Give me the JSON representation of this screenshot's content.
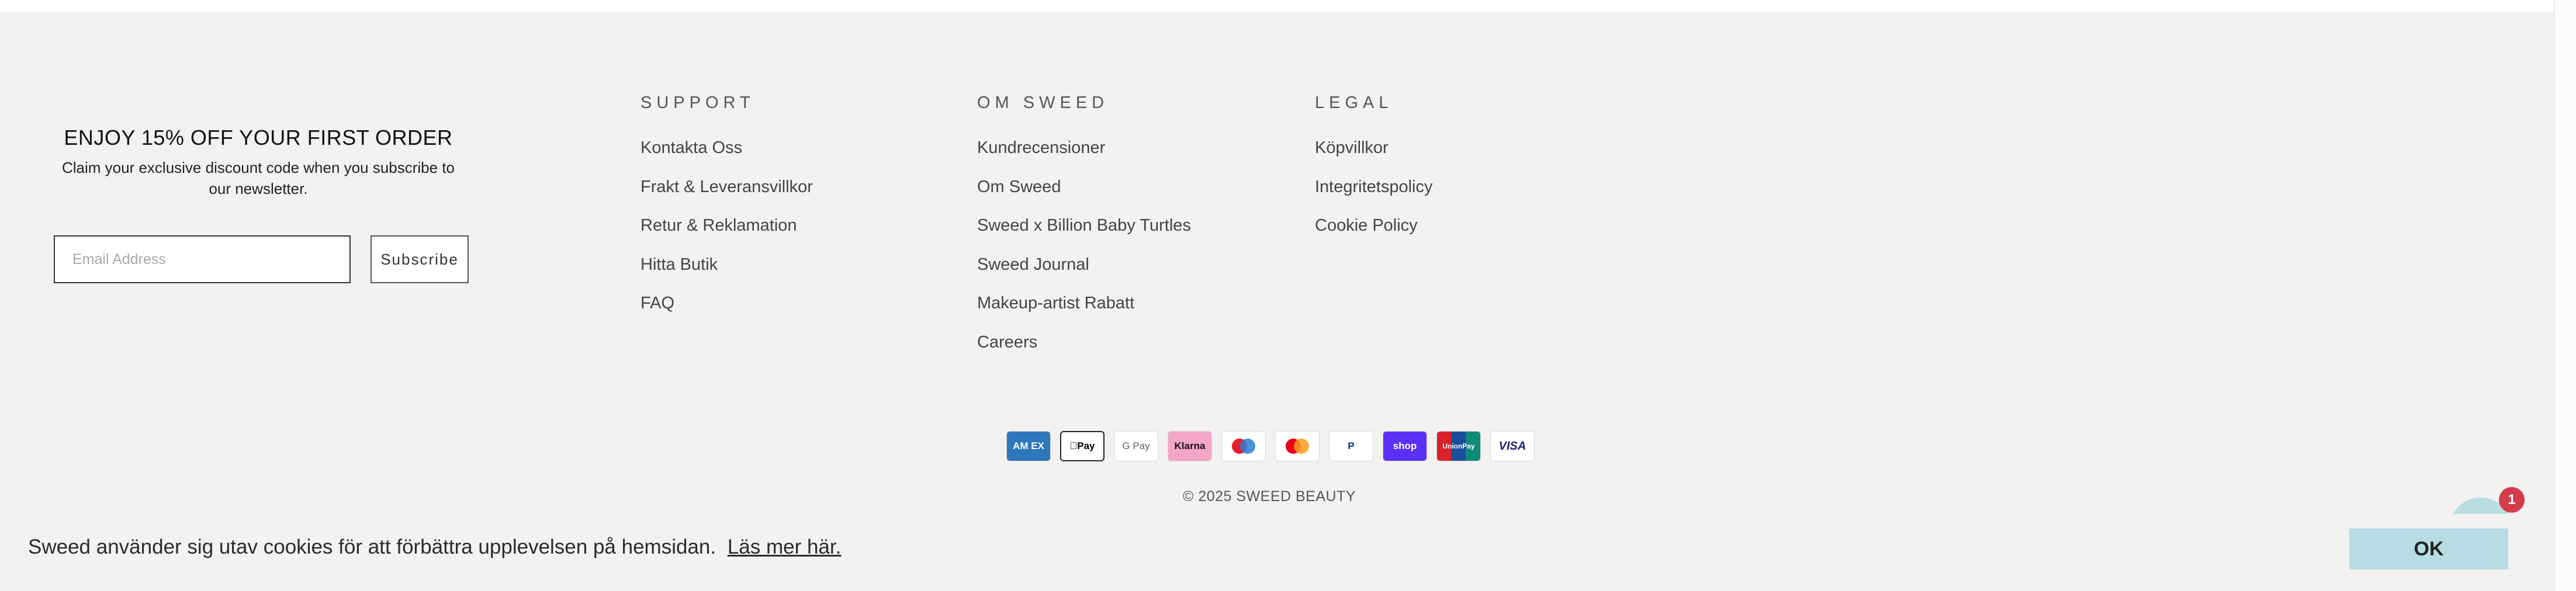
{
  "newsletter": {
    "title": "ENJOY 15% OFF YOUR FIRST ORDER",
    "text": "Claim your exclusive discount code when you subscribe to our newsletter.",
    "email_placeholder": "Email Address",
    "subscribe_label": "Subscribe"
  },
  "support": {
    "title": "SUPPORT",
    "items": [
      "Kontakta Oss",
      "Frakt & Leveransvillkor",
      "Retur & Reklamation",
      "Hitta Butik",
      "FAQ"
    ]
  },
  "om": {
    "title": "OM SWEED",
    "items": [
      "Kundrecensioner",
      "Om Sweed",
      "Sweed x Billion Baby Turtles",
      "Sweed Journal",
      "Makeup-artist Rabatt",
      "Careers"
    ]
  },
  "legal": {
    "title": "LEGAL",
    "items": [
      "Köpvillkor",
      "Integritetspolicy",
      "Cookie Policy"
    ]
  },
  "payments": [
    {
      "label": "AM EX",
      "icon": "amex-icon",
      "bg": "#2e77bc",
      "fg": "#ffffff"
    },
    {
      "label": "Pay",
      "icon": "apple-pay-icon",
      "bg": "#ffffff",
      "fg": "#000000"
    },
    {
      "label": "G Pay",
      "icon": "google-pay-icon",
      "bg": "#ffffff",
      "fg": "#5f6368"
    },
    {
      "label": "Klarna",
      "icon": "klarna-icon",
      "bg": "#f4a6c7",
      "fg": "#17120f"
    },
    {
      "label": "",
      "icon": "maestro-icon",
      "bg": "#ffffff",
      "fg": "#000000"
    },
    {
      "label": "",
      "icon": "mastercard-icon",
      "bg": "#ffffff",
      "fg": "#000000"
    },
    {
      "label": "P",
      "icon": "paypal-icon",
      "bg": "#ffffff",
      "fg": "#003087"
    },
    {
      "label": "shop",
      "icon": "shop-pay-icon",
      "bg": "#5a31f4",
      "fg": "#ffffff"
    },
    {
      "label": "UnionPay",
      "icon": "unionpay-icon",
      "bg": "#d8232a",
      "fg": "#ffffff"
    },
    {
      "label": "VISA",
      "icon": "visa-icon",
      "bg": "#ffffff",
      "fg": "#1a1f71"
    }
  ],
  "copyright": "© 2025 SWEED BEAUTY",
  "chat": {
    "badge_count": "1"
  },
  "cookie": {
    "text": "Sweed använder sig utav cookies för att förbättra upplevelsen på hemsidan.",
    "link": "Läs mer här.",
    "ok_label": "OK"
  }
}
